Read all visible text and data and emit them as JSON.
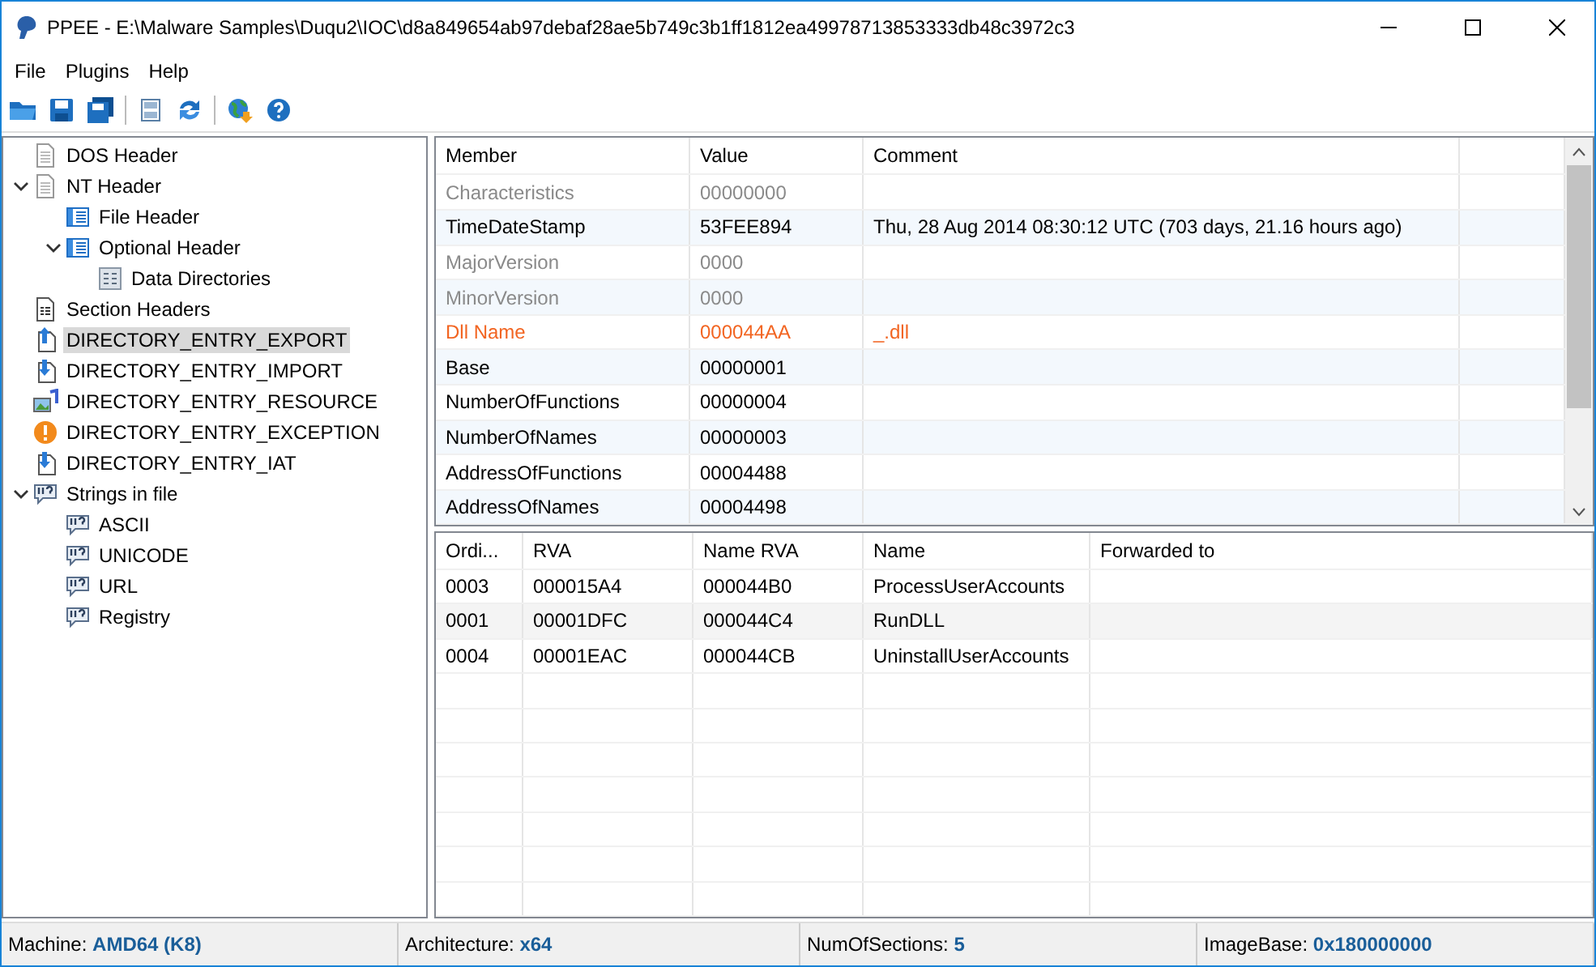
{
  "window": {
    "title": "PPEE - E:\\Malware Samples\\Duqu2\\IOC\\d8a849654ab97debaf28ae5b749c3b1ff1812ea49978713853333db48c3972c3"
  },
  "menu": [
    "File",
    "Plugins",
    "Help"
  ],
  "tree": [
    {
      "label": "DOS Header",
      "kind": "page",
      "selected": false
    },
    {
      "label": "NT Header",
      "kind": "page",
      "selected": false,
      "expanded": true,
      "children": [
        {
          "label": "File Header",
          "kind": "table",
          "selected": false
        },
        {
          "label": "Optional Header",
          "kind": "table",
          "selected": false,
          "expanded": true,
          "children": [
            {
              "label": "Data Directories",
              "kind": "grid",
              "selected": false
            }
          ]
        }
      ]
    },
    {
      "label": "Section Headers",
      "kind": "sections",
      "selected": false
    },
    {
      "label": "DIRECTORY_ENTRY_EXPORT",
      "kind": "export",
      "selected": true
    },
    {
      "label": "DIRECTORY_ENTRY_IMPORT",
      "kind": "import",
      "selected": false
    },
    {
      "label": "DIRECTORY_ENTRY_RESOURCE",
      "kind": "resource",
      "selected": false
    },
    {
      "label": "DIRECTORY_ENTRY_EXCEPTION",
      "kind": "exception",
      "selected": false
    },
    {
      "label": "DIRECTORY_ENTRY_IAT",
      "kind": "import",
      "selected": false
    },
    {
      "label": "Strings in file",
      "kind": "strings",
      "selected": false,
      "expanded": true,
      "children": [
        {
          "label": "ASCII",
          "kind": "strings",
          "selected": false
        },
        {
          "label": "UNICODE",
          "kind": "strings",
          "selected": false
        },
        {
          "label": "URL",
          "kind": "strings",
          "selected": false
        },
        {
          "label": "Registry",
          "kind": "strings",
          "selected": false
        }
      ]
    }
  ],
  "members_table": {
    "columns": [
      "Member",
      "Value",
      "Comment"
    ],
    "rows": [
      {
        "kind": "dim",
        "member": "Characteristics",
        "value": "00000000"
      },
      {
        "kind": "normal",
        "member": "TimeDateStamp",
        "value": "53FEE894",
        "comment": "Thu, 28 Aug 2014 08:30:12 UTC (703 days, 21.16 hours ago)"
      },
      {
        "kind": "dim",
        "member": "MajorVersion",
        "value": "0000"
      },
      {
        "kind": "dim",
        "member": "MinorVersion",
        "value": "0000"
      },
      {
        "kind": "warning",
        "member": "Dll Name",
        "value": "000044AA",
        "comment": "_.dll"
      },
      {
        "kind": "normal",
        "member": "Base",
        "value": "00000001"
      },
      {
        "kind": "normal",
        "member": "NumberOfFunctions",
        "value": "00000004"
      },
      {
        "kind": "normal",
        "member": "NumberOfNames",
        "value": "00000003"
      },
      {
        "kind": "normal",
        "member": "AddressOfFunctions",
        "value": "00004488"
      },
      {
        "kind": "normal",
        "member": "AddressOfNames",
        "value": "00004498"
      }
    ]
  },
  "exports_table": {
    "columns": [
      "Ordi...",
      "RVA",
      "Name RVA",
      "Name",
      "Forwarded to"
    ],
    "rows": [
      [
        "0003",
        "000015A4",
        "000044B0",
        "ProcessUserAccounts"
      ],
      [
        "0001",
        "00001DFC",
        "000044C4",
        "RunDLL"
      ],
      [
        "0004",
        "00001EAC",
        "000044CB",
        "UninstallUserAccounts"
      ]
    ]
  },
  "status_bar": [
    {
      "label": "Machine:",
      "value": "AMD64 (K8)"
    },
    {
      "label": "Architecture:",
      "value": "x64"
    },
    {
      "label": "NumOfSections:",
      "value": "5"
    },
    {
      "label": "ImageBase:",
      "value": "0x180000000"
    }
  ]
}
